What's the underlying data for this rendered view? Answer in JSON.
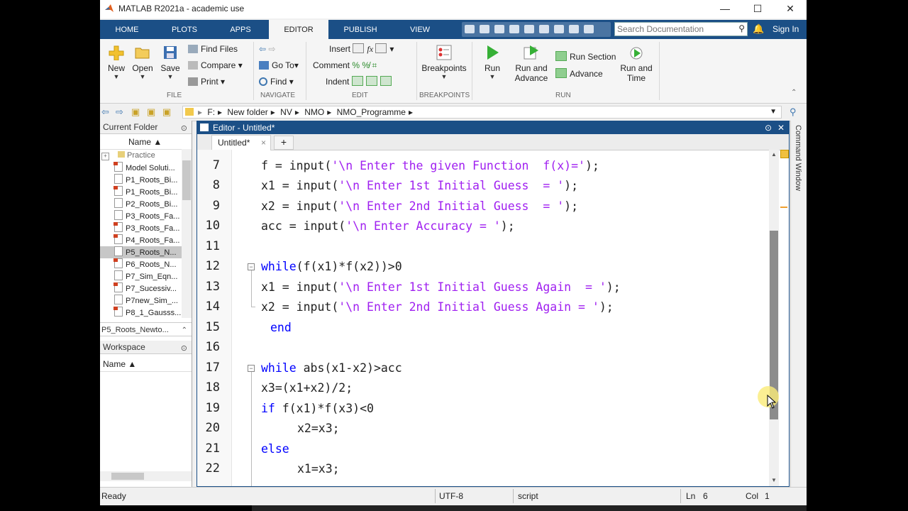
{
  "window": {
    "title": "MATLAB R2021a - academic use",
    "minimize": "—",
    "maximize": "☐",
    "close": "✕"
  },
  "ribbon_tabs": [
    "HOME",
    "PLOTS",
    "APPS",
    "EDITOR",
    "PUBLISH",
    "VIEW"
  ],
  "active_tab": "EDITOR",
  "search": {
    "placeholder": "Search Documentation"
  },
  "sign_in": "Sign In",
  "file_group": {
    "new": "New",
    "open": "Open",
    "save": "Save",
    "find_files": "Find Files",
    "compare": "Compare",
    "print": "Print",
    "label": "FILE"
  },
  "navigate_group": {
    "go_to": "Go To",
    "find": "Find",
    "label": "NAVIGATE"
  },
  "edit_group": {
    "insert": "Insert",
    "comment": "Comment",
    "indent": "Indent",
    "label": "EDIT"
  },
  "breakpoints_group": {
    "breakpoints": "Breakpoints",
    "label": "BREAKPOINTS"
  },
  "run_group": {
    "run": "Run",
    "run_and_advance_1": "Run and",
    "run_and_advance_2": "Advance",
    "run_section": "Run Section",
    "advance": "Advance",
    "run_and_time_1": "Run and",
    "run_and_time_2": "Time",
    "label": "RUN"
  },
  "path": [
    "F:",
    "New folder",
    "NV",
    "NMO",
    "NMO_Programme"
  ],
  "current_folder": {
    "title": "Current Folder",
    "column": "Name ▲",
    "files": [
      "Practice",
      "Model Soluti...",
      "P1_Roots_Bi...",
      "P1_Roots_Bi...",
      "P2_Roots_Bi...",
      "P3_Roots_Fa...",
      "P3_Roots_Fa...",
      "P4_Roots_Fa...",
      "P5_Roots_N...",
      "P6_Roots_N...",
      "P7_Sim_Eqn...",
      "P7_Sucessiv...",
      "P7new_Sim_...",
      "P8_1_Gausss..."
    ],
    "selected_index": 8,
    "details": "P5_Roots_Newto..."
  },
  "workspace": {
    "title": "Workspace",
    "column": "Name ▲"
  },
  "editor": {
    "title": "Editor - Untitled*",
    "tab": "Untitled*",
    "plus": "+"
  },
  "code": {
    "line_numbers": [
      "7",
      "8",
      "9",
      "10",
      "11",
      "12",
      "13",
      "14",
      "15",
      "16",
      "17",
      "18",
      "19",
      "20",
      "21",
      "22"
    ],
    "l7": {
      "pre": "f = input(",
      "str": "'\\n Enter the given Function  f(x)='",
      "post": ");"
    },
    "l8": {
      "pre": "x1 = input(",
      "str": "'\\n Enter 1st Initial Guess  = '",
      "post": ");"
    },
    "l9": {
      "pre": "x2 = input(",
      "str": "'\\n Enter 2nd Initial Guess  = '",
      "post": ");"
    },
    "l10": {
      "pre": "acc = input(",
      "str": "'\\n Enter Accuracy = '",
      "post": ");"
    },
    "l12": {
      "kw": "while",
      "rest": "(f(x1)*f(x2))>0"
    },
    "l13": {
      "pre": "x1 = input(",
      "str": "'\\n Enter 1st Initial Guess Again  = '",
      "post": ");"
    },
    "l14": {
      "pre": "x2 = input(",
      "str": "'\\n Enter 2nd Initial Guess Again = '",
      "post": ");"
    },
    "l15": {
      "kw": "end"
    },
    "l17": {
      "kw": "while",
      "rest": " abs(x1-x2)>acc"
    },
    "l18": "x3=(x1+x2)/2;",
    "l19": {
      "kw": "if",
      "rest": " f(x1)*f(x3)<0"
    },
    "l20": "x2=x3;",
    "l21": {
      "kw": "else"
    },
    "l22": "x1=x3;"
  },
  "command_window": "Command Window",
  "status": {
    "ready": "Ready",
    "encoding": "UTF-8",
    "type": "script",
    "ln_label": "Ln",
    "ln": "6",
    "col_label": "Col",
    "col": "1"
  },
  "colors": {
    "ribbon_blue": "#1b4f86",
    "keyword": "#0000ff",
    "string": "#a020f0"
  }
}
